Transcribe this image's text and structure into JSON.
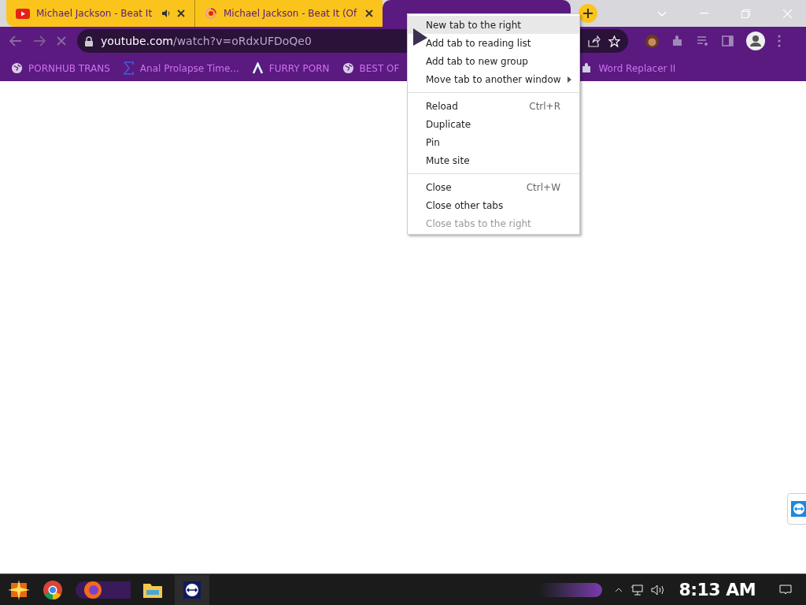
{
  "tabs": [
    {
      "title": "Michael Jackson - Beat It",
      "kind": "video",
      "audio": true,
      "selected": false
    },
    {
      "title": "Michael Jackson - Beat It (Of",
      "kind": "loading",
      "audio": false,
      "selected": false
    },
    {
      "kind": "plain",
      "audio": false,
      "selected": true
    }
  ],
  "address": {
    "host": "youtube.com",
    "path": "/watch?v=oRdxUFDoQe0"
  },
  "bookmarks": [
    {
      "label": "PORNHUB TRANS",
      "kind": "globe"
    },
    {
      "label": "Anal Prolapse Time...",
      "kind": "sigma"
    },
    {
      "label": "FURRY PORN",
      "kind": "lambda"
    },
    {
      "label": "BEST OF",
      "kind": "globe"
    },
    {
      "label": "Word Replacer II",
      "kind": "puzzle"
    }
  ],
  "context_menu": [
    [
      {
        "label": "New tab to the right",
        "selected": true,
        "disabled": false
      },
      {
        "label": "Add tab to reading list",
        "selected": false,
        "disabled": false
      },
      {
        "label": "Add tab to new group",
        "selected": false,
        "disabled": false
      },
      {
        "label": "Move tab to another window",
        "submenu": true,
        "selected": false,
        "disabled": false
      }
    ],
    [
      {
        "label": "Reload",
        "shortcut": "Ctrl+R",
        "selected": false,
        "disabled": false
      },
      {
        "label": "Duplicate",
        "selected": false,
        "disabled": false
      },
      {
        "label": "Pin",
        "selected": false,
        "disabled": false
      },
      {
        "label": "Mute site",
        "selected": false,
        "disabled": false
      }
    ],
    [
      {
        "label": "Close",
        "shortcut": "Ctrl+W",
        "selected": false,
        "disabled": false
      },
      {
        "label": "Close other tabs",
        "selected": false,
        "disabled": false
      },
      {
        "label": "Close tabs to the right",
        "selected": false,
        "disabled": true
      }
    ]
  ],
  "taskbar": {
    "clock": "8:13 AM"
  }
}
